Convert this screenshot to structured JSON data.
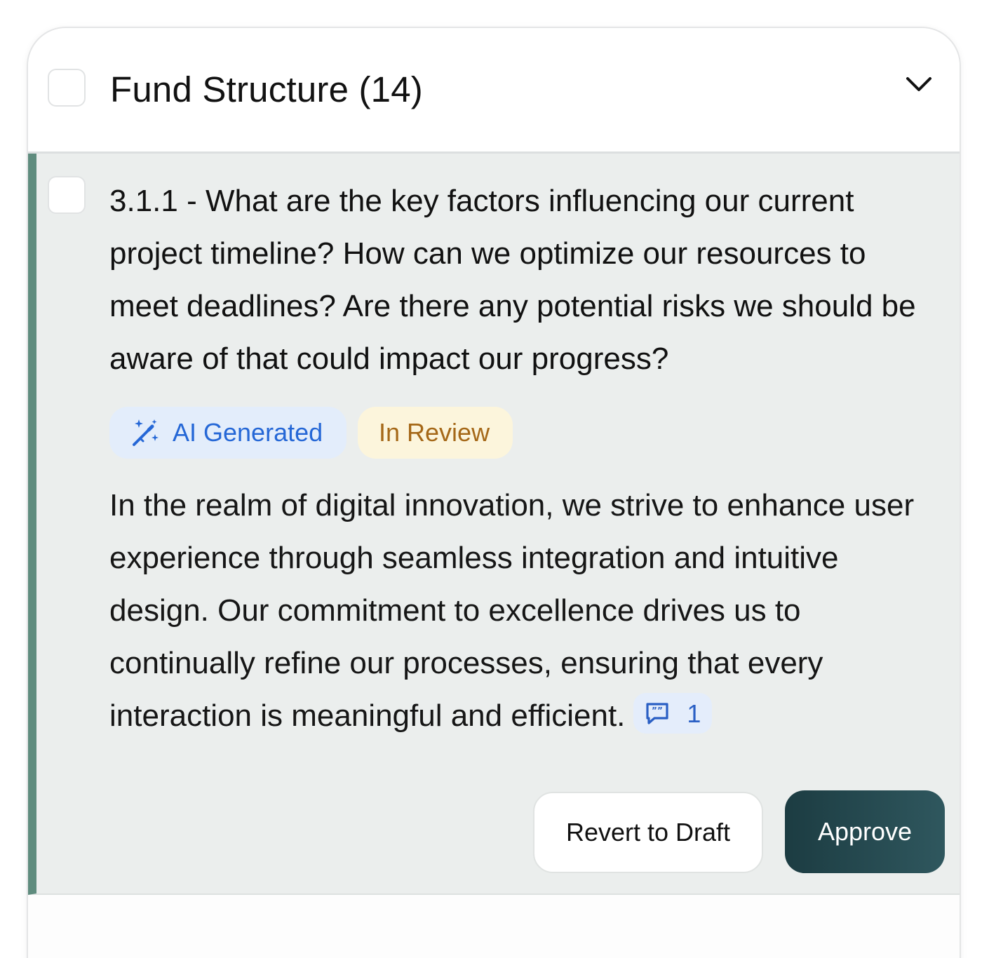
{
  "section": {
    "title": "Fund Structure (14)"
  },
  "question": {
    "text": "3.1.1 - What are the key factors influencing our current project timeline? How can we optimize our resources to meet deadlines? Are there any potential risks we should be aware of that could impact our progress?",
    "badges": {
      "ai_label": "AI Generated",
      "status_label": "In Review"
    },
    "answer": "In the realm of digital innovation, we strive to enhance user experience through seamless integration and intuitive design. Our commitment to excellence drives us to continually refine our processes, ensuring that every interaction is meaningful and efficient.",
    "comment_count": "1"
  },
  "actions": {
    "revert_label": "Revert to Draft",
    "approve_label": "Approve"
  },
  "colors": {
    "accent_bar": "#5f8c7e",
    "ai_badge_text": "#2567d6",
    "ai_badge_bg": "#e3edfb",
    "review_badge_text": "#a56818",
    "review_badge_bg": "#fcf5dc",
    "approve_bg": "#1c3c42",
    "section_bg": "#ebeeed"
  },
  "icons": {
    "ai_badge": "magic-wand-icon",
    "comment": "comment-icon",
    "collapse": "chevron-down-icon"
  }
}
